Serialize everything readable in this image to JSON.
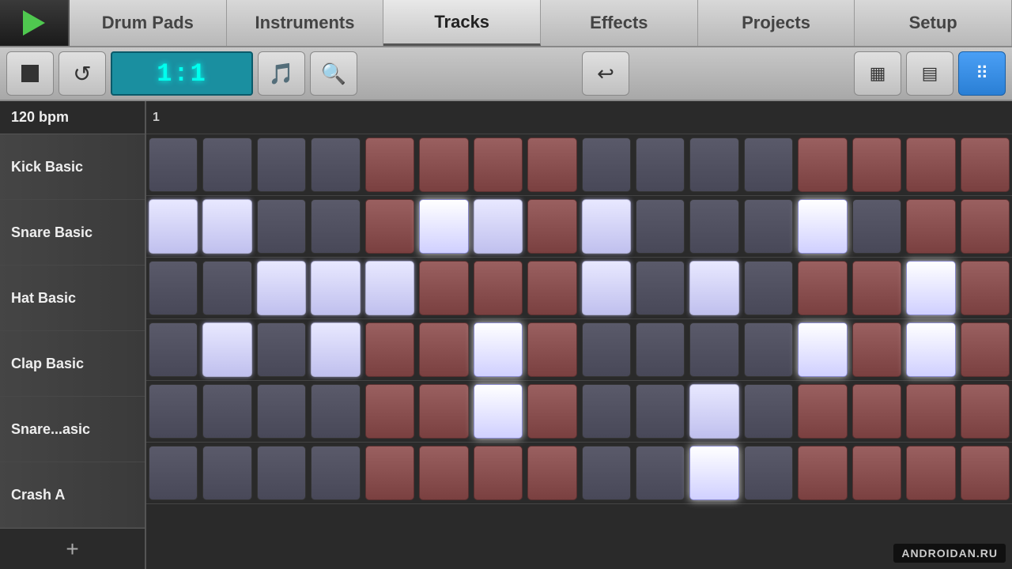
{
  "nav": {
    "tabs": [
      "Drum Pads",
      "Instruments",
      "Tracks",
      "Effects",
      "Projects",
      "Setup"
    ],
    "active": "Tracks"
  },
  "toolbar": {
    "stop_label": "■",
    "loop_label": "↺",
    "lcd_value": "1:1",
    "metronome_label": "⚗",
    "search_label": "🔍",
    "undo_label": "↩",
    "grid1_label": "▦",
    "grid2_label": "▤",
    "grid3_label": "⠿"
  },
  "bpm": "120 bpm",
  "bar_start": "1",
  "tracks": [
    {
      "name": "Kick Basic"
    },
    {
      "name": "Snare Basic"
    },
    {
      "name": "Hat Basic"
    },
    {
      "name": "Clap Basic"
    },
    {
      "name": "Snare...asic"
    },
    {
      "name": "Crash A"
    }
  ],
  "watermark": "ANDROIDAN.RU"
}
